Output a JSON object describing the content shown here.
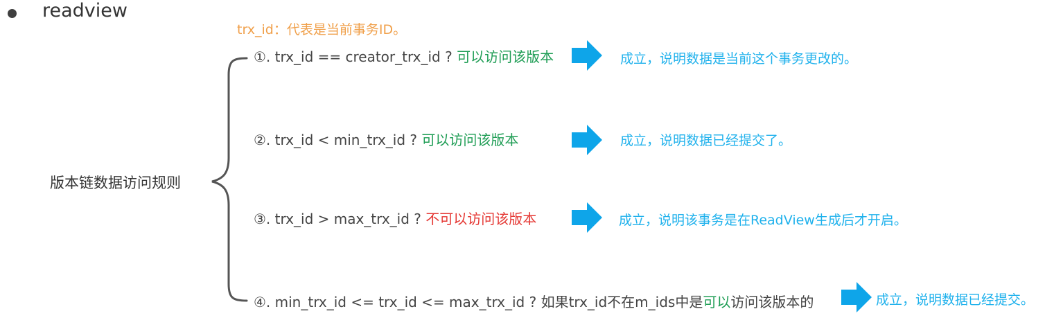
{
  "title": "readview",
  "note": "trx_id：代表是当前事务ID。",
  "root_label": "版本链数据访问规则",
  "colors": {
    "note": "#f0a04b",
    "green": "#1f9d55",
    "red": "#e53935",
    "result_blue": "#1fb1ec",
    "arrow": "#0ea5e9",
    "text": "#444444",
    "brace": "#555555"
  },
  "rules": [
    {
      "condition": "①. trx_id  == creator_trx_id ? ",
      "verdict": "可以访问该版本",
      "result": "成立，说明数据是当前这个事务更改的。"
    },
    {
      "condition": "②. trx_id < min_trx_id ? ",
      "verdict": "可以访问该版本",
      "result": "成立，说明数据已经提交了。"
    },
    {
      "condition": "③. trx_id > max_trx_id ?  ",
      "verdict": "不可以访问该版本",
      "result": "成立，说明该事务是在ReadView生成后才开启。"
    },
    {
      "condition": "④. min_trx_id <= trx_id <= max_trx_id ?  如果trx_id不在m_ids中是",
      "verdict": "可以",
      "suffix": "访问该版本的",
      "result": "成立，说明数据已经提交。"
    }
  ]
}
